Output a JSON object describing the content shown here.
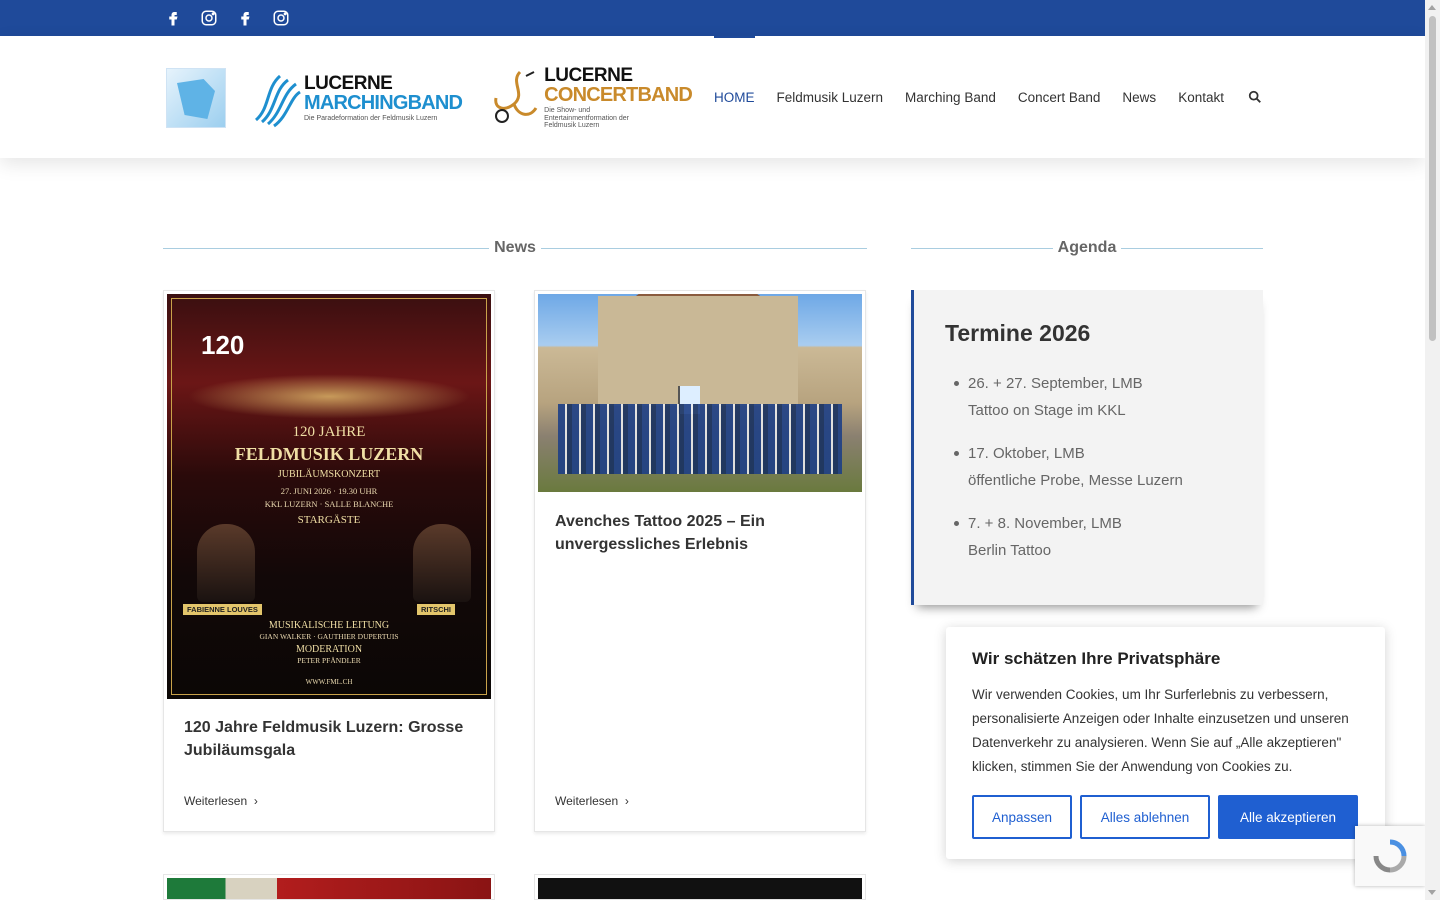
{
  "social": [
    "facebook-icon",
    "instagram-icon",
    "facebook-icon",
    "instagram-icon"
  ],
  "logos": {
    "lmb": {
      "line1": "LUCERNE",
      "line2": "MARCHINGBAND",
      "tag": "Die Paradeformation der Feldmusik Luzern"
    },
    "lcb": {
      "line1": "LUCERNE",
      "line2": "CONCERTBAND",
      "tag": "Die Show- und Entertainmentformation der Feldmusik Luzern"
    }
  },
  "nav": {
    "items": [
      {
        "label": "HOME",
        "active": true
      },
      {
        "label": "Feldmusik Luzern"
      },
      {
        "label": "Marching Band"
      },
      {
        "label": "Concert Band"
      },
      {
        "label": "News"
      },
      {
        "label": "Kontakt"
      }
    ]
  },
  "sections": {
    "news": "News",
    "agenda": "Agenda"
  },
  "poster": {
    "badge": "120",
    "line1": "120 JAHRE",
    "line2": "FELDMUSIK LUZERN",
    "line3": "JUBILÄUMSKONZERT",
    "date": "27. JUNI 2026 · 19.30 UHR",
    "venue": "KKL LUZERN · SALLE BLANCHE",
    "guests": "STARGÄSTE",
    "guest1": "FABIENNE LOUVES",
    "guest2": "RITSCHI",
    "lead_label": "MUSIKALISCHE LEITUNG",
    "lead_names": "GIAN WALKER · GAUTHIER DUPERTUIS",
    "mod_label": "MODERATION",
    "mod_name": "PETER PFÄNDLER",
    "url": "WWW.FML.CH"
  },
  "cards": [
    {
      "title": "120 Jahre Feldmusik Luzern: Grosse Jubiläumsgala",
      "more": "Weiterlesen"
    },
    {
      "title": "Avenches Tattoo 2025 – Ein unvergessliches Erlebnis",
      "more": "Weiterlesen"
    }
  ],
  "agenda": {
    "title": "Termine 2026",
    "items": [
      {
        "line1": "26. + 27. September, LMB",
        "line2": "Tattoo on Stage im KKL"
      },
      {
        "line1": "17. Oktober, LMB",
        "line2": "öffentliche Probe, Messe Luzern"
      },
      {
        "line1": "7. + 8. November, LMB",
        "line2": "Berlin Tattoo"
      }
    ]
  },
  "cookie": {
    "title": "Wir schätzen Ihre Privatsphäre",
    "text": "Wir verwenden Cookies, um Ihr Surferlebnis zu verbessern, personalisierte Anzeigen oder Inhalte einzusetzen und unseren Datenverkehr zu analysieren. Wenn Sie auf „Alle akzeptieren\" klicken, stimmen Sie der Anwendung von Cookies zu.",
    "btn_customize": "Anpassen",
    "btn_reject": "Alles ablehnen",
    "btn_accept": "Alle akzeptieren"
  },
  "colors": {
    "brand": "#1f4a9a",
    "button": "#1f5fd1"
  }
}
